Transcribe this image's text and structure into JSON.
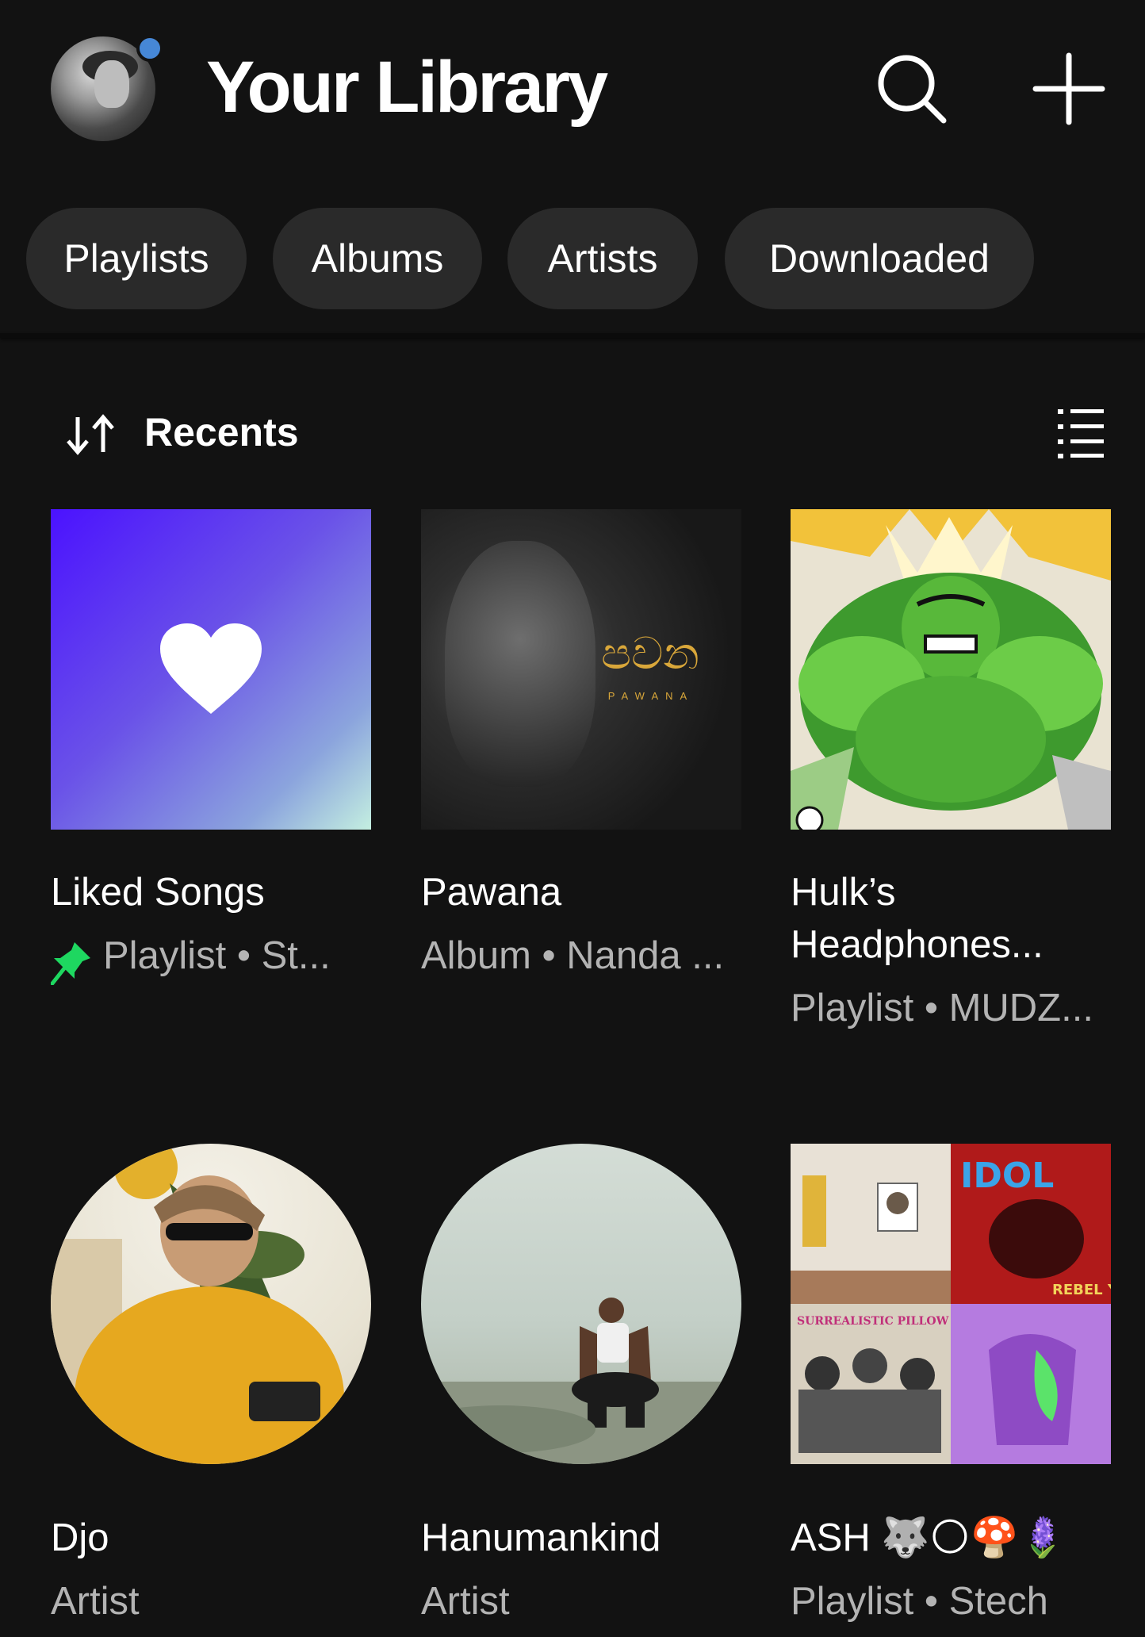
{
  "header": {
    "title": "Your Library",
    "avatar_icon": "profile-avatar",
    "notification_color": "#4687d6",
    "search_icon": "search-icon",
    "add_icon": "plus-icon"
  },
  "filters": [
    {
      "label": "Playlists"
    },
    {
      "label": "Albums"
    },
    {
      "label": "Artists"
    },
    {
      "label": "Downloaded"
    }
  ],
  "sort": {
    "label": "Recents",
    "sort_icon": "sort-arrows-icon",
    "view_icon": "list-view-icon"
  },
  "items": [
    {
      "name": "Liked Songs",
      "subtitle": "Playlist • St...",
      "pinned": true,
      "pin_color": "#1ed760",
      "shape": "square"
    },
    {
      "name": "Pawana",
      "subtitle": "Album • Nanda ...",
      "art_text": "පවන",
      "art_subtext": "PAWANA",
      "shape": "square"
    },
    {
      "name_line1": "Hulk’s",
      "name_line2": "Headphones...",
      "subtitle": "Playlist • MUDZ...",
      "shape": "square"
    },
    {
      "name": "Djo",
      "subtitle": "Artist",
      "shape": "circle"
    },
    {
      "name": "Hanumankind",
      "subtitle": "Artist",
      "shape": "circle"
    },
    {
      "name": "ASH 🐺🌕🍄🪻",
      "subtitle": "Playlist • Stech",
      "shape": "square",
      "mosaic_text_1": "IDOL",
      "mosaic_text_2": "REBEL YELL",
      "mosaic_text_3": "SURREALISTIC PILLOW"
    }
  ],
  "colors": {
    "background": "#121212",
    "chip_bg": "#2a2a2a",
    "secondary_text": "#b3b3b3",
    "liked_gradient_start": "#4b12ff",
    "liked_gradient_end": "#c4efe0"
  }
}
